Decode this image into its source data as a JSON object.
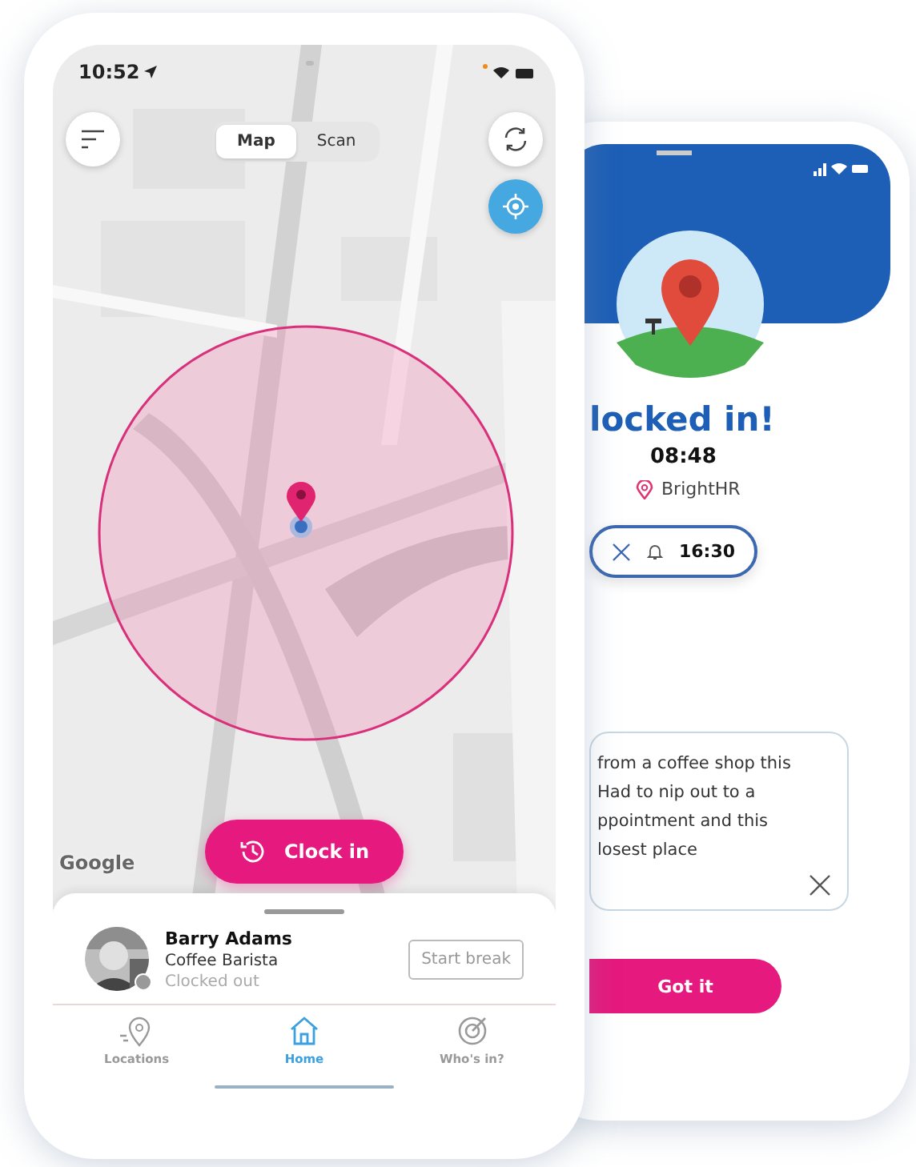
{
  "map_screen": {
    "status_bar": {
      "time": "10:52"
    },
    "segments": [
      {
        "label": "Map",
        "selected": true
      },
      {
        "label": "Scan",
        "selected": false
      }
    ],
    "map": {
      "kind": "picture",
      "attribution": "Google"
    },
    "clock_in_button": "Clock in",
    "user": {
      "name": "Barry Adams",
      "role": "Coffee Barista",
      "status": "Clocked out",
      "break_button": "Start break"
    },
    "nav": [
      {
        "label": "Locations",
        "kind": "pin",
        "selected": false
      },
      {
        "label": "Home",
        "kind": "home",
        "selected": true
      },
      {
        "label": "Who's in?",
        "kind": "target",
        "selected": false
      }
    ]
  },
  "confirm_screen": {
    "title": "locked in!",
    "time": "08:48",
    "location": "BrightHR",
    "reminder": "16:30",
    "note_lines": [
      "from a coffee shop this",
      "Had to nip out to a",
      "ppointment and this",
      "losest place"
    ],
    "button": "Got it"
  }
}
